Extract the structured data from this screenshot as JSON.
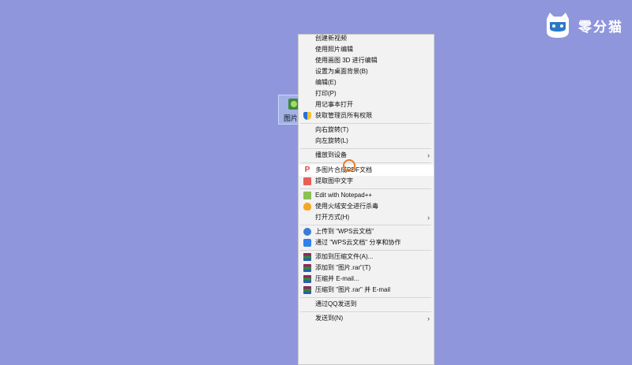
{
  "desktop": {
    "file_label": "图片"
  },
  "logo": {
    "text": "零分猫"
  },
  "menu": {
    "items": [
      {
        "label": "创建新视频"
      },
      {
        "label": "使用照片编辑"
      },
      {
        "label": "使用画图 3D 进行编辑"
      },
      {
        "label": "设置为桌面背景(B)"
      },
      {
        "label": "编辑(E)"
      },
      {
        "label": "打印(P)"
      },
      {
        "label": "用记事本打开"
      },
      {
        "label": "获取管理员所有权限"
      },
      {
        "label": "向右旋转(T)"
      },
      {
        "label": "向左旋转(L)"
      },
      {
        "label": "播放到设备"
      },
      {
        "label": "多图片合成PDF文档"
      },
      {
        "label": "提取图中文字"
      },
      {
        "label": "Edit with Notepad++"
      },
      {
        "label": "使用火绒安全进行杀毒"
      },
      {
        "label": "打开方式(H)"
      },
      {
        "label": "上传到 \"WPS云文档\""
      },
      {
        "label": "通过 \"WPS云文档\" 分享和协作"
      },
      {
        "label": "添加到压缩文件(A)..."
      },
      {
        "label": "添加到 \"图片.rar\"(T)"
      },
      {
        "label": "压缩并 E-mail..."
      },
      {
        "label": "压缩到 \"图片.rar\" 并 E-mail"
      },
      {
        "label": "通过QQ发送到"
      },
      {
        "label": "发送到(N)"
      }
    ],
    "submenu_arrow": "›"
  }
}
